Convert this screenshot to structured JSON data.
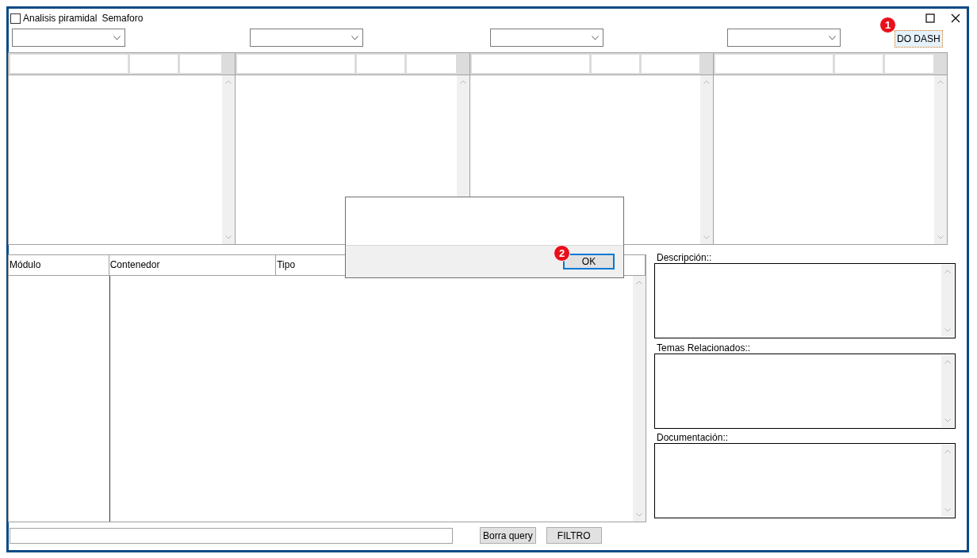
{
  "options": {
    "checkbox": {
      "label": "Analisis piramidal",
      "checked": false
    },
    "label": "Semaforo"
  },
  "dropdowns": [
    {
      "kind": "dropdown"
    },
    {
      "kind": "dropdown"
    },
    {
      "kind": "dropdown"
    },
    {
      "kind": "dropdown"
    }
  ],
  "do_dash_button": {
    "label": "DO DASH",
    "focused": true,
    "marker": "1"
  },
  "lists": [
    {
      "kind": "list"
    },
    {
      "kind": "list"
    },
    {
      "kind": "list"
    },
    {
      "kind": "list"
    }
  ],
  "grid": {
    "columns": [
      "Módulo",
      "Contenedor",
      "Tipo"
    ]
  },
  "details": [
    {
      "label": "Descripción::"
    },
    {
      "label": "Temas Relacionados::"
    },
    {
      "label": "Documentación::"
    }
  ],
  "footer": {
    "buttons": [
      "Borra query",
      "FILTRO"
    ]
  },
  "dialog": {
    "button": "OK",
    "marker": "2"
  }
}
